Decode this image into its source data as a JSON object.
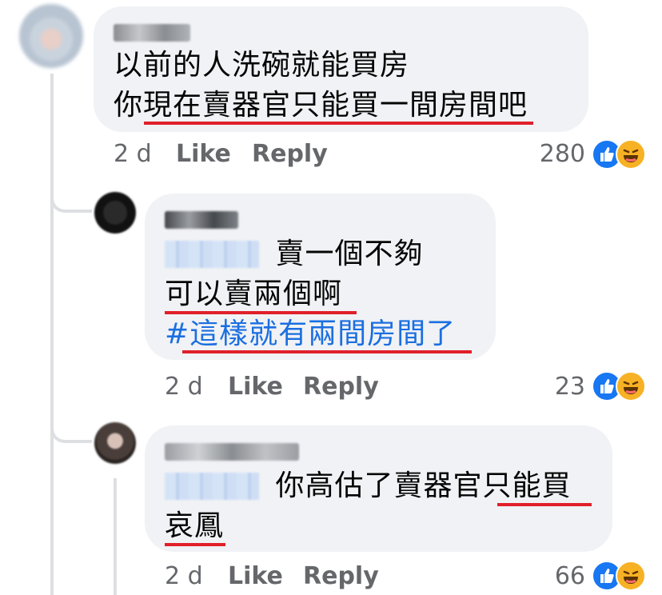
{
  "comments": [
    {
      "time": "2 d",
      "like_label": "Like",
      "reply_label": "Reply",
      "reaction_count": "280",
      "lines": [
        "以前的人洗碗就能買房",
        "你現在賣器官只能買一間房間吧"
      ]
    },
    {
      "time": "2 d",
      "like_label": "Like",
      "reply_label": "Reply",
      "reaction_count": "23",
      "line1_rest": "賣一個不夠",
      "line2": "可以賣兩個啊",
      "hashtag": "#這樣就有兩間房間了"
    },
    {
      "time": "2 d",
      "like_label": "Like",
      "reply_label": "Reply",
      "reaction_count": "66",
      "line1_rest": "你高估了賣器官只能買",
      "line2": "哀鳳"
    }
  ],
  "colors": {
    "bubble": "#f0f2f5",
    "meta_text": "#65676b",
    "hashtag": "#1b6fe0",
    "underline": "#e0202a",
    "like_reaction": "#1877f2",
    "haha_reaction": "#f7b125"
  },
  "icons": [
    "avatar",
    "like-reaction-icon",
    "haha-reaction-icon"
  ]
}
